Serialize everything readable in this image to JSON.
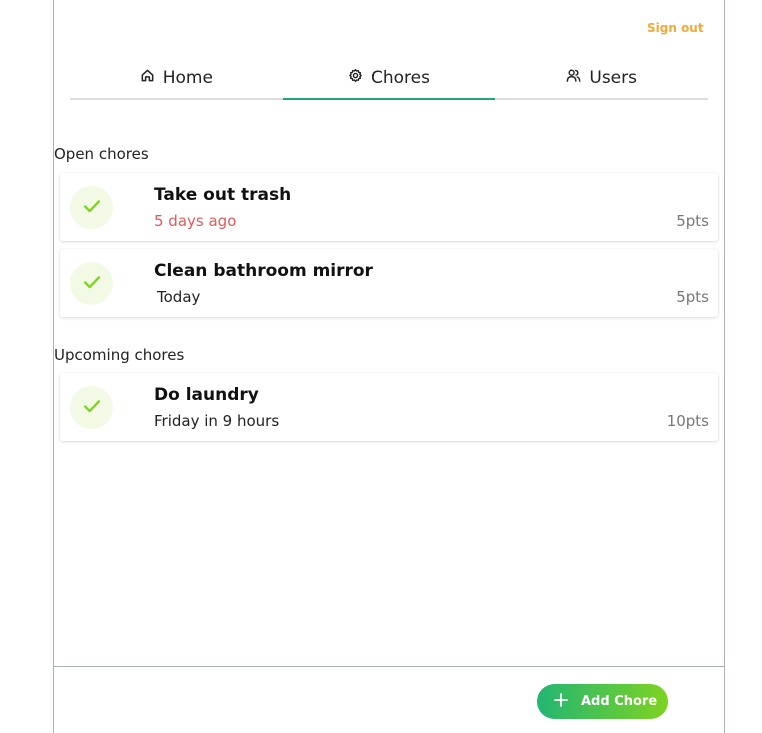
{
  "header": {
    "sign_out_label": "Sign out"
  },
  "tabs": [
    {
      "label": "Home",
      "icon": "home-icon",
      "active": false
    },
    {
      "label": "Chores",
      "icon": "gear-icon",
      "active": true
    },
    {
      "label": "Users",
      "icon": "users-icon",
      "active": false
    }
  ],
  "open_chores": {
    "title": "Open chores",
    "items": [
      {
        "name": "Take out trash",
        "when": "5 days ago",
        "points": "5pts",
        "overdue": true
      },
      {
        "name": "Clean bathroom mirror",
        "when": "Today",
        "points": "5pts",
        "overdue": false
      }
    ]
  },
  "upcoming_chores": {
    "title": "Upcoming chores",
    "items": [
      {
        "name": "Do laundry",
        "when": "Friday in 9 hours",
        "points": "10pts",
        "overdue": false
      }
    ]
  },
  "footer": {
    "add_chore_label": "Add Chore"
  },
  "colors": {
    "accent_tab": "#23a57f",
    "sign_out": "#f0a93a",
    "overdue": "#e05a5a",
    "check": "#7ed321",
    "check_bg": "#f2fae6",
    "button_gradient_start": "#22b573",
    "button_gradient_end": "#7ed321"
  }
}
